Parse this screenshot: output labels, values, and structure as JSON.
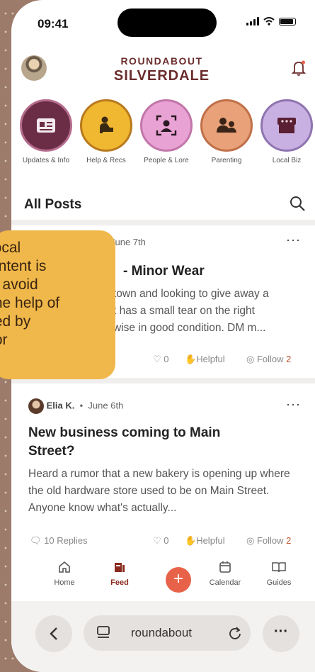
{
  "status": {
    "time": "09:41"
  },
  "header": {
    "brand_top": "ROUNDABOUT",
    "brand_main": "SILVERDALE"
  },
  "categories": [
    {
      "label": "Updates & Info",
      "color": "#6b2d45",
      "ring": "#b56c8d"
    },
    {
      "label": "Help & Recs",
      "color": "#f0b731",
      "ring": "#b87a1e"
    },
    {
      "label": "People & Lore",
      "color": "#e8a2d4",
      "ring": "#c276a9"
    },
    {
      "label": "Parenting",
      "color": "#e8a178",
      "ring": "#c07048"
    },
    {
      "label": "Local Biz",
      "color": "#c9b0e2",
      "ring": "#8f74b0"
    }
  ],
  "feed": {
    "title": "All Posts"
  },
  "posts": [
    {
      "date": "June 7th",
      "title": "- Minor Wear",
      "body_lines": [
        "town and looking to give away a",
        "t has a small tear on the right",
        "wise in good condition. DM m..."
      ],
      "likes": "0",
      "helpful": "Helpful",
      "follow": "Follow",
      "follow_count": "2"
    },
    {
      "author": "Elia K.",
      "date": "June 6th",
      "title": "New business coming to Main Street?",
      "body": "Heard a rumor that a new bakery is opening up where the old hardware store used to be on Main Street. Anyone know what's actually...",
      "replies": "10 Replies",
      "likes": "0",
      "helpful": "Helpful",
      "follow": "Follow",
      "follow_count": "2"
    }
  ],
  "tooltip": {
    "lines": [
      "local",
      "ontent is",
      "o avoid",
      "the help of",
      "ted by",
      "tor"
    ]
  },
  "tabs": {
    "home": "Home",
    "feed": "Feed",
    "add": "+",
    "calendar": "Calendar",
    "guides": "Guides"
  },
  "browser": {
    "url": "roundabout",
    "more": "···"
  },
  "colors": {
    "brand": "#6b2d2d",
    "accent": "#e8624a",
    "tooltip": "#f0b84a"
  }
}
